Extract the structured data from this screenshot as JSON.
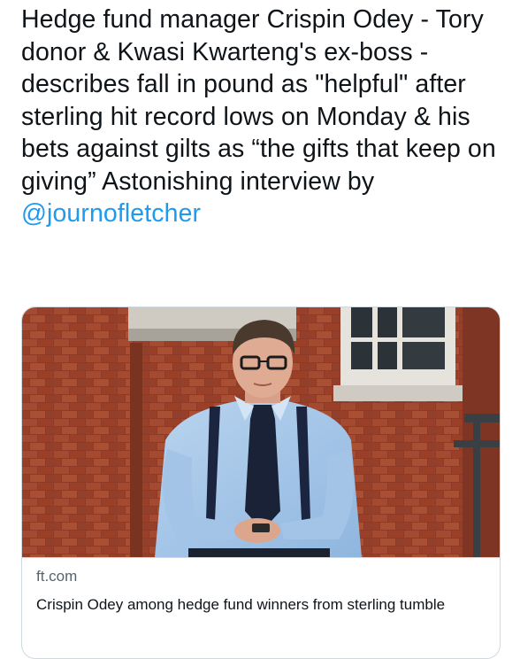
{
  "tweet": {
    "text_before": "Hedge fund manager Crispin Odey - Tory donor & Kwasi Kwarteng's ex-boss - describes fall in pound as \"helpful\" after sterling hit record lows on Monday & his bets against gilts as “the gifts that keep on giving”  Astonishing interview by ",
    "mention": "@journofletcher"
  },
  "link_card": {
    "domain": "ft.com",
    "title": "Crispin Odey among hedge fund winners from sterling tumble"
  },
  "colors": {
    "text": "#0f1419",
    "link": "#1d9bf0",
    "secondary": "#536471",
    "border": "#cfd9de"
  }
}
